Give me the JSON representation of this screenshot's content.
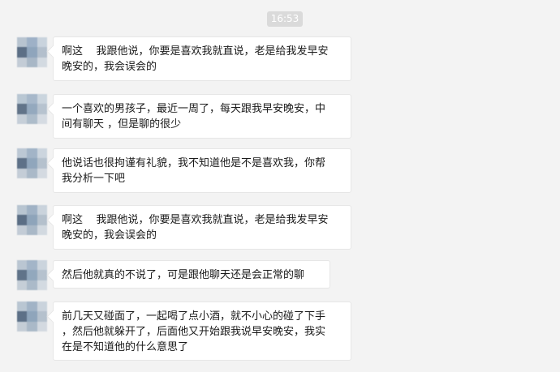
{
  "timestamp": "16:53",
  "colors": {
    "background": "#f3f3f3",
    "bubble": "#ffffff",
    "timestamp_bg": "#dadada"
  },
  "messages": [
    {
      "text": "啊这    我跟他说，你要是喜欢我就直说，老是给我发早安\n晚安的，我会误会的",
      "avatar": "blurred-avatar-icon"
    },
    {
      "text": "一个喜欢的男孩子，最近一周了，每天跟我早安晚安，中\n间有聊天 ，但是聊的很少",
      "avatar": "blurred-avatar-icon"
    },
    {
      "text": "他说话也很拘谨有礼貌，我不知道他是不是喜欢我，你帮\n我分析一下吧",
      "avatar": "blurred-avatar-icon"
    },
    {
      "text": "啊这    我跟他说，你要是喜欢我就直说，老是给我发早安\n晚安的，我会误会的",
      "avatar": "blurred-avatar-icon"
    },
    {
      "text": "然后他就真的不说了，可是跟他聊天还是会正常的聊",
      "avatar": "blurred-avatar-icon"
    },
    {
      "text": "前几天又碰面了，一起喝了点小酒，就不小心的碰了下手\n，然后他就躲开了，后面他又开始跟我说早安晚安，我实\n在是不知道他的什么意思了",
      "avatar": "blurred-avatar-icon"
    }
  ]
}
